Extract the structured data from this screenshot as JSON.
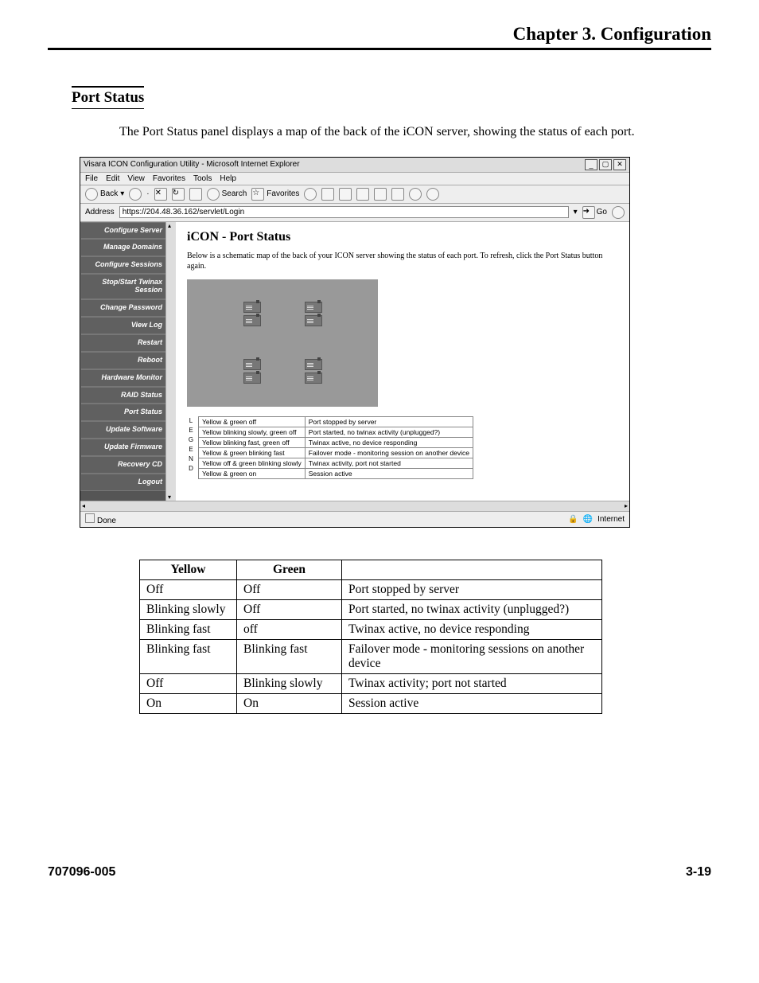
{
  "chapter_header": "Chapter 3.  Configuration",
  "section_title": "Port Status",
  "body_text": "The Port Status panel displays a map of the back of the iCON server, showing the status of each port.",
  "browser": {
    "window_title": "Visara ICON Configuration Utility - Microsoft Internet Explorer",
    "menu": [
      "File",
      "Edit",
      "View",
      "Favorites",
      "Tools",
      "Help"
    ],
    "back_label": "Back",
    "search_label": "Search",
    "favorites_label": "Favorites",
    "address_label": "Address",
    "url": "https://204.48.36.162/servlet/Login",
    "go_label": "Go",
    "sidebar": [
      "Configure Server",
      "Manage Domains",
      "Configure Sessions",
      "Stop/Start Twinax Session",
      "Change Password",
      "View Log",
      "Restart",
      "Reboot",
      "Hardware Monitor",
      "RAID Status",
      "Port Status",
      "Update Software",
      "Update Firmware",
      "Recovery CD",
      "Logout"
    ],
    "main_heading": "iCON - Port Status",
    "main_desc": "Below is a schematic map of the back of your ICON server showing the status of each port. To refresh, click the Port Status button again.",
    "legend_side": "L E G E N D",
    "legend_rows": [
      [
        "Yellow & green off",
        "Port stopped by server"
      ],
      [
        "Yellow blinking slowly, green off",
        "Port started, no twinax activity (unplugged?)"
      ],
      [
        "Yellow blinking fast, green off",
        "Twinax active, no device responding"
      ],
      [
        "Yellow & green blinking fast",
        "Failover mode - monitoring session on another device"
      ],
      [
        "Yellow off & green blinking slowly",
        "Twinax activity, port not started"
      ],
      [
        "Yellow & green on",
        "Session active"
      ]
    ],
    "status_done": "Done",
    "status_zone": "Internet"
  },
  "table": {
    "headers": [
      "Yellow",
      "Green",
      ""
    ],
    "rows": [
      [
        "Off",
        "Off",
        "Port stopped by server"
      ],
      [
        "Blinking slowly",
        "Off",
        "Port started, no twinax activity (unplugged?)"
      ],
      [
        "Blinking fast",
        "off",
        "Twinax active, no device responding"
      ],
      [
        "Blinking fast",
        "Blinking fast",
        "Failover mode - monitoring sessions on another device"
      ],
      [
        "Off",
        "Blinking slowly",
        "Twinax activity; port not started"
      ],
      [
        "On",
        "On",
        "Session active"
      ]
    ]
  },
  "footer_left": "707096-005",
  "footer_right": "3-19"
}
